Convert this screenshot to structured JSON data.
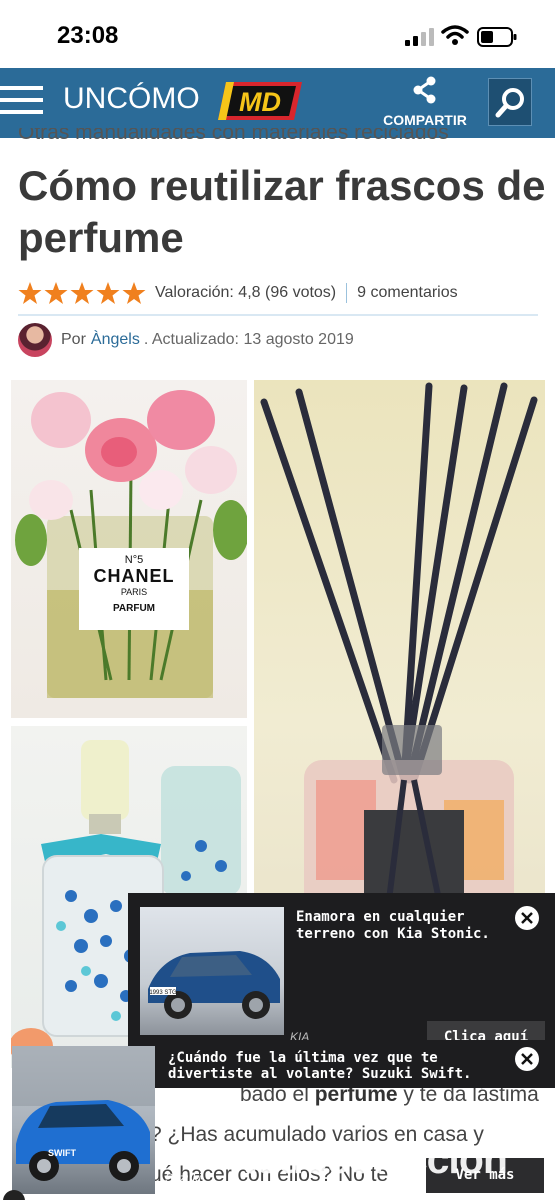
{
  "status_bar": {
    "time": "23:08"
  },
  "header": {
    "logo": "UNCÓMO",
    "share_label": "COMPARTIR",
    "partner_logo": "MD"
  },
  "article": {
    "breadcrumb": "Otras manualidades con materiales reciclados",
    "title": "Cómo reutilizar frascos de perfume",
    "rating_text": "Valoración: 4,8 (96 votos)",
    "stars": 5,
    "comments": "9 comentarios",
    "by_label": "Por",
    "author": "Àngels",
    "updated": ". Actualizado: 13 agosto 2019",
    "images": {
      "label": {
        "number": "N°5",
        "brand": "CHANEL",
        "city": "PARIS",
        "type": "PARFUM"
      }
    },
    "body_line1_a": "bado el ",
    "body_line1_b": "perfume",
    "body_line1_c": " y te da lástima",
    "body_line2": "? ¿Has acumulado varios en casa y",
    "body_line3": "ué hacer con ellos? No te"
  },
  "ads": {
    "ad1": {
      "title": "Enamora en cualquier terreno con Kia Stonic.",
      "brand": "KIA",
      "cta": "Clica aquí",
      "plate": "1993 STG"
    },
    "ad2": {
      "title": "¿Cuándo fue la última vez que te divertiste al volante? Suzuki Swift.",
      "brand": "Suzuki",
      "cta": "Ver más",
      "car_badge": "SWIFT"
    }
  },
  "watermark": "todocoleccion",
  "colors": {
    "header_bg": "#2b6b98",
    "star": "#f0801e",
    "link": "#2b6b98",
    "md_red": "#d8262d",
    "md_yellow": "#f6c519"
  }
}
